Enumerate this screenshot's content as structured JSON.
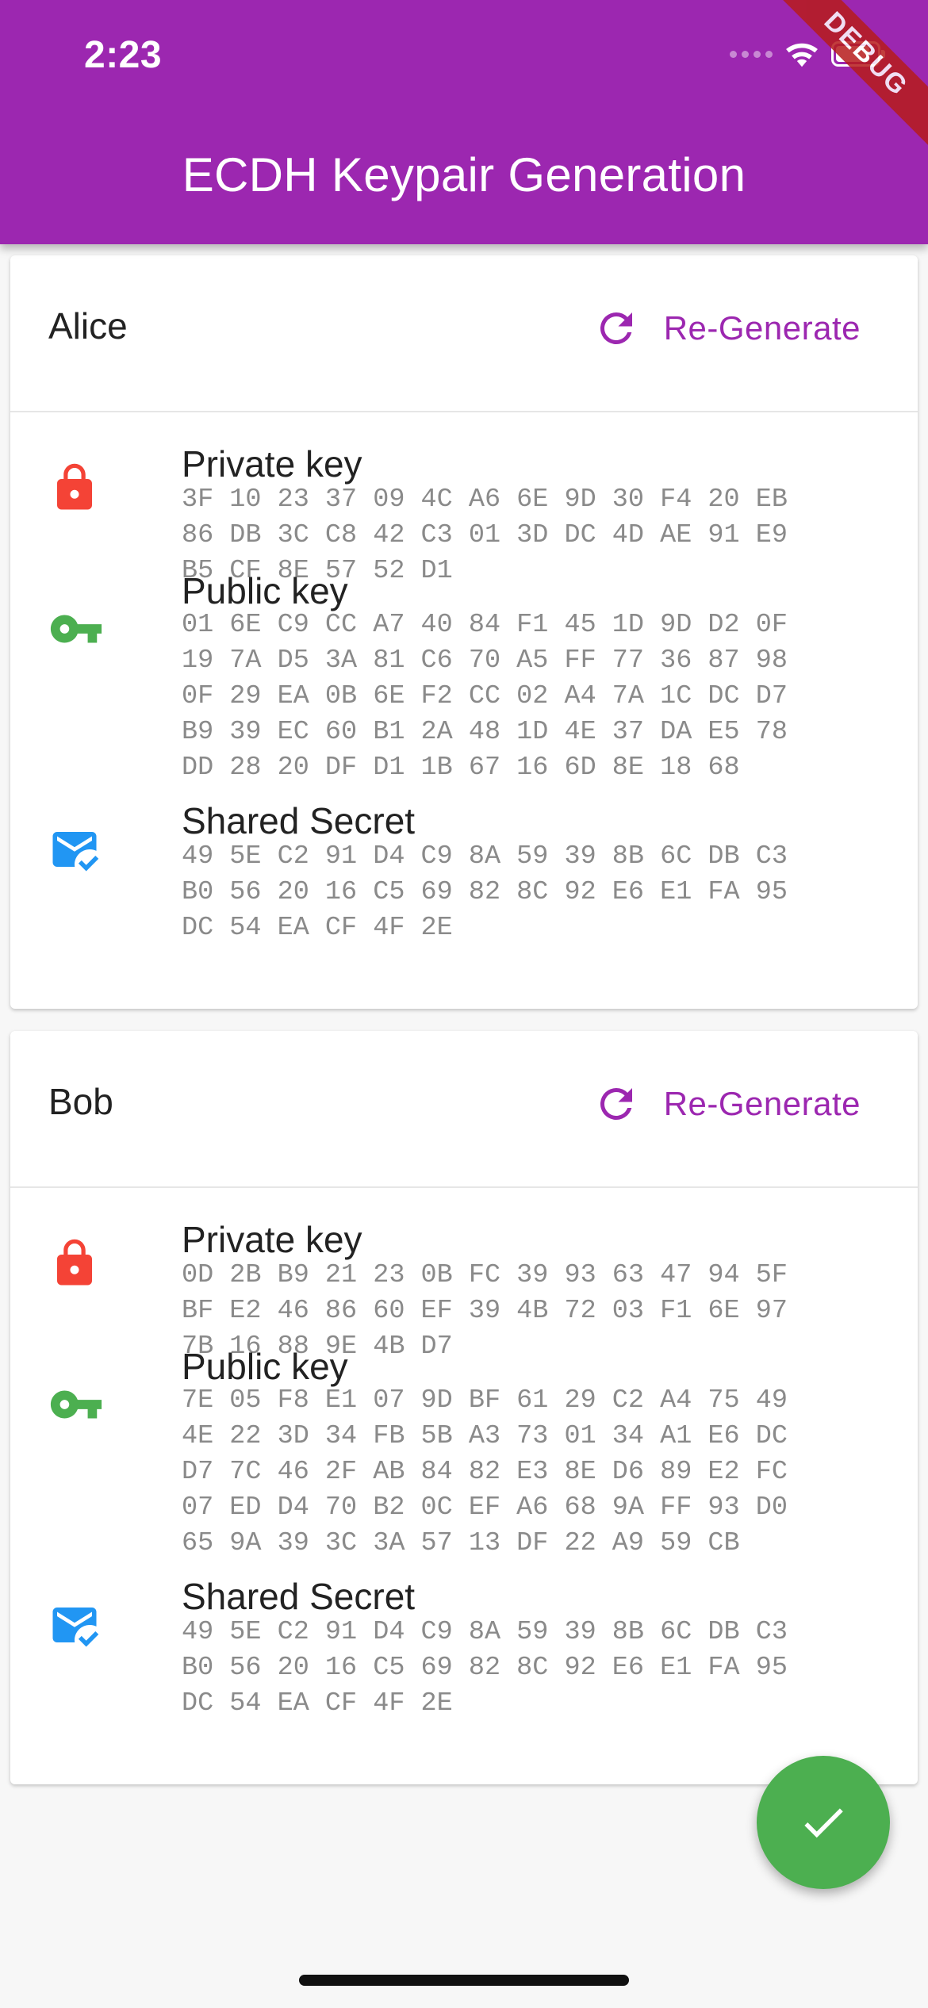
{
  "status_bar": {
    "time": "2:23",
    "debug_label": "DEBUG"
  },
  "app_bar": {
    "title": "ECDH Keypair Generation"
  },
  "labels": {
    "private_key": "Private key",
    "public_key": "Public key",
    "shared_secret": "Shared Secret",
    "regenerate": "Re-Generate"
  },
  "icons": {
    "private": "lock-icon",
    "public": "key-icon",
    "secret": "mark-email-read-icon",
    "regenerate": "refresh-icon",
    "fab": "check-icon"
  },
  "colors": {
    "primary": "#9c27b0",
    "lock": "#f44336",
    "key": "#4caf50",
    "mail": "#2196f3",
    "fab": "#4caf50"
  },
  "alice": {
    "name": "Alice",
    "private_key": "3F 10 23 37 09 4C A6 6E 9D 30 F4 20 EB\n86 DB 3C C8 42 C3 01 3D DC 4D AE 91 E9\nB5 CF 8E 57 52 D1",
    "public_key": "01 6E C9 CC A7 40 84 F1 45 1D 9D D2 0F\n19 7A D5 3A 81 C6 70 A5 FF 77 36 87 98\n0F 29 EA 0B 6E F2 CC 02 A4 7A 1C DC D7\nB9 39 EC 60 B1 2A 48 1D 4E 37 DA E5 78\nDD 28 20 DF D1 1B 67 16 6D 8E 18 68",
    "shared_secret": "49 5E C2 91 D4 C9 8A 59 39 8B 6C DB C3\nB0 56 20 16 C5 69 82 8C 92 E6 E1 FA 95\nDC 54 EA CF 4F 2E"
  },
  "bob": {
    "name": "Bob",
    "private_key": "0D 2B B9 21 23 0B FC 39 93 63 47 94 5F\nBF E2 46 86 60 EF 39 4B 72 03 F1 6E 97\n7B 16 88 9E 4B D7",
    "public_key": "7E 05 F8 E1 07 9D BF 61 29 C2 A4 75 49\n4E 22 3D 34 FB 5B A3 73 01 34 A1 E6 DC\nD7 7C 46 2F AB 84 82 E3 8E D6 89 E2 FC\n07 ED D4 70 B2 0C EF A6 68 9A FF 93 D0\n65 9A 39 3C 3A 57 13 DF 22 A9 59 CB",
    "shared_secret": "49 5E C2 91 D4 C9 8A 59 39 8B 6C DB C3\nB0 56 20 16 C5 69 82 8C 92 E6 E1 FA 95\nDC 54 EA CF 4F 2E"
  }
}
